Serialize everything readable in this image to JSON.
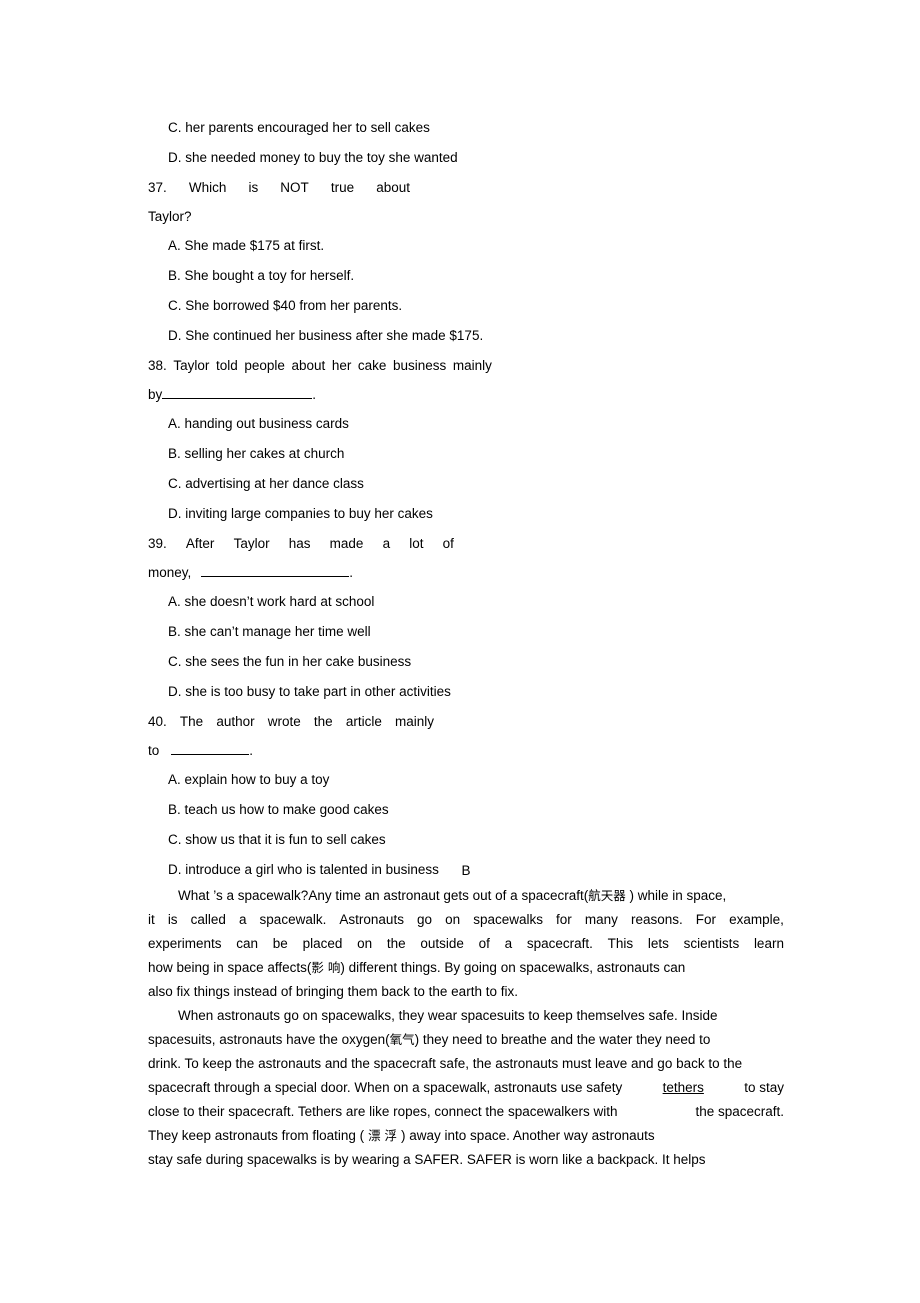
{
  "questions": [
    {
      "id": "q36-options-tail",
      "options": [
        "C. her parents encouraged her to sell cakes",
        "D. she needed money to buy the toy she wanted"
      ]
    },
    {
      "id": "q37",
      "number": "37.",
      "stem_words": [
        "Which",
        "is",
        "NOT",
        "true",
        "about"
      ],
      "stem_line2": "Taylor?",
      "options": [
        "A. She made $175 at first.",
        "B. She bought a toy for herself.",
        "C. She borrowed $40 from her parents.",
        "D. She continued her business after she made $175."
      ]
    },
    {
      "id": "q38",
      "number": "38.",
      "stem_words": [
        "Taylor",
        "told",
        "people",
        "about",
        "her",
        "cake",
        "business",
        "mainly"
      ],
      "stem_line2_prefix": "by",
      "stem_line2_suffix": ".",
      "options": [
        "A. handing out business cards",
        "B. selling her cakes at church",
        "C. advertising at her dance class",
        "D. inviting large companies to buy her cakes"
      ]
    },
    {
      "id": "q39",
      "number": "39.",
      "stem_words": [
        "After",
        "Taylor",
        "has",
        "made",
        "a",
        "lot",
        "of"
      ],
      "stem_line2_prefix": "money,",
      "stem_line2_suffix": ".",
      "options": [
        "A. she doesn’t work hard at school",
        "B. she can’t manage her time well",
        "C. she sees the fun in her cake business",
        "D. she is too busy to take part in other activities"
      ]
    },
    {
      "id": "q40",
      "number": "40.",
      "stem_words": [
        "The",
        "author",
        "wrote",
        "the",
        "article",
        "mainly"
      ],
      "stem_line2_prefix": "to",
      "stem_line2_suffix": ".",
      "options": [
        "A. explain how to buy a toy",
        "B. teach us how to make good cakes",
        "C. show us that it is fun to sell cakes",
        "D. introduce a girl who is talented in business"
      ]
    }
  ],
  "section": {
    "letter": "B"
  },
  "passage": {
    "paragraph1": {
      "line1": [
        "What ’s a spacewalk?Any time an astronaut gets out of a spacecraft(",
        "航天器",
        "  ) while in space,"
      ],
      "line2_words": [
        "it",
        "is",
        "called",
        "a",
        "spacewalk.",
        "Astronauts",
        "go",
        "on",
        "spacewalks",
        "for",
        "many",
        "reasons.",
        "For",
        "example,"
      ],
      "line3_words": [
        "experiments",
        "can",
        "be",
        "placed",
        "on",
        "the",
        "outside",
        "of",
        "a",
        "spacecraft.",
        "This",
        "lets",
        "scientists",
        "learn"
      ],
      "line4": [
        "how  being  in   space affects(",
        "影 响",
        ") different things. By going on spacewalks, astronauts can"
      ],
      "line5": "also fix things instead of bringing them back to the earth to fix."
    },
    "paragraph2": {
      "line1": "When astronauts go  on spacewalks, they  wear spacesuits to  keep themselves safe. Inside",
      "line2": [
        "spacesuits, astronauts have the  oxygen(",
        "氧气",
        ") they need to breathe and the water they need to"
      ],
      "line3": "drink. To keep the astronauts and the spacecraft safe, the astronauts must leave and go back to the",
      "line4_a": "spacecraft through a special door. When on a spacewalk, astronauts use safety",
      "line4_underlined": "tethers",
      "line4_b": "to stay",
      "line5_a": "close to  their  spacecraft. Tethers are like ropes, connect the spacewalkers with",
      "line5_b": "the  spacecraft.",
      "line6": [
        "They keep astronauts   from    floating (",
        " 漂 浮 ",
        ")   away   into   space. Another   way   astronauts"
      ],
      "line7": "stay   safe   during spacewalks is by wearing a SAFER. SAFER is worn like a backpack. It helps"
    }
  }
}
